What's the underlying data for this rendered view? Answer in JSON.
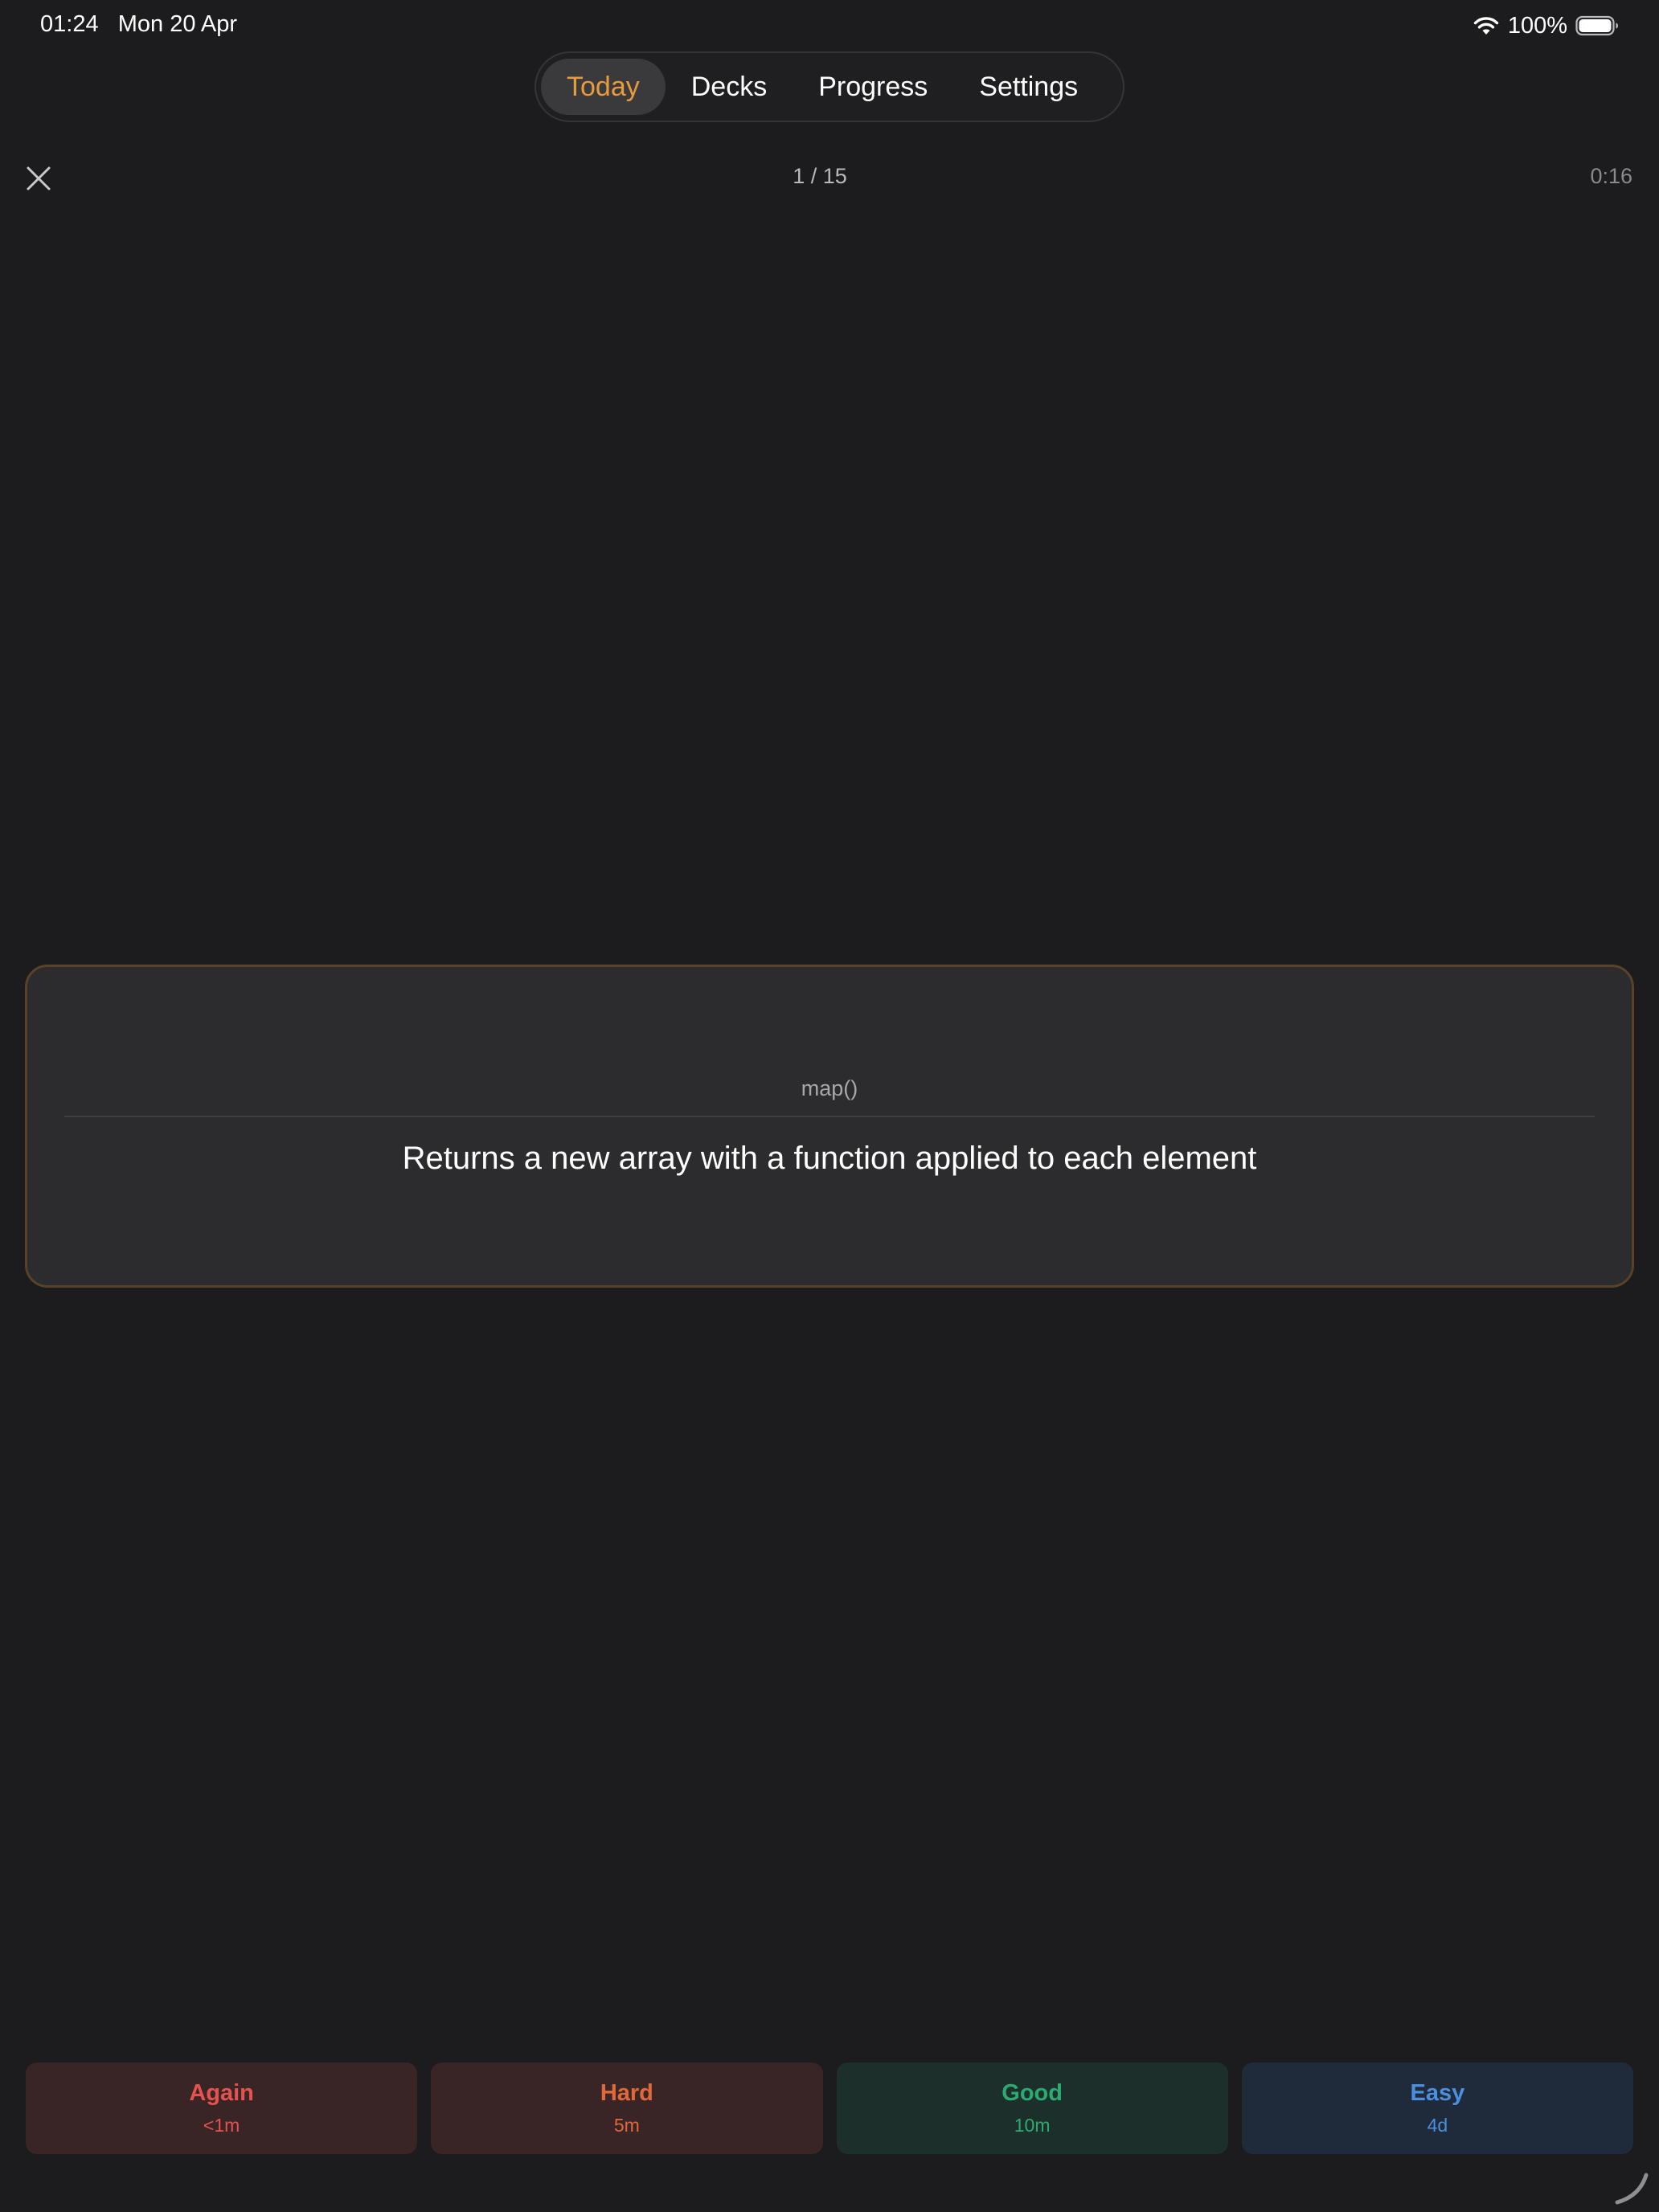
{
  "status_bar": {
    "time": "01:24",
    "date": "Mon 20 Apr",
    "battery": "100%"
  },
  "tabs": [
    {
      "label": "Today",
      "active": true
    },
    {
      "label": "Decks",
      "active": false
    },
    {
      "label": "Progress",
      "active": false
    },
    {
      "label": "Settings",
      "active": false
    }
  ],
  "session": {
    "counter": "1 / 15",
    "timer": "0:16"
  },
  "card": {
    "front": "map()",
    "back": "Returns a new array with a function applied to each element"
  },
  "answers": [
    {
      "label": "Again",
      "interval": "<1m",
      "color": "#e5524f"
    },
    {
      "label": "Hard",
      "interval": "5m",
      "color": "#e0693a"
    },
    {
      "label": "Good",
      "interval": "10m",
      "color": "#2bab73"
    },
    {
      "label": "Easy",
      "interval": "4d",
      "color": "#4a90de"
    }
  ],
  "colors": {
    "background": "#1c1c1e",
    "accent": "#e89a3c",
    "card": "#2c2c2e",
    "card_border": "#5a4227"
  },
  "icons": {
    "close": "close-icon",
    "wifi": "wifi-icon",
    "battery": "battery-icon",
    "corner": "resize-handle-icon"
  }
}
